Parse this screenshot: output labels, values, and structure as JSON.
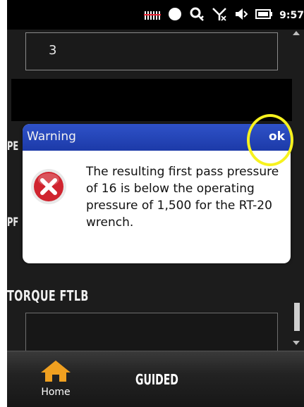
{
  "status_bar": {
    "time": "9:57",
    "icons": [
      "signal-bars-icon",
      "record-icon",
      "sync-icon",
      "no-signal-icon",
      "volume-icon",
      "battery-icon"
    ]
  },
  "form": {
    "field1_value": "3",
    "label_pe_partial": "PE",
    "label_pf_partial": "PF",
    "torque_label": "TORQUE FTLB"
  },
  "dialog": {
    "title": "Warning",
    "ok_label": "ok",
    "icon": "error-icon",
    "message": "The resulting first pass pressure of 16 is below the operating pressure of 1,500 for the RT-20 wrench."
  },
  "bottom_nav": {
    "home_label": "Home",
    "guided_label": "GUIDED"
  },
  "colors": {
    "dialog_header": "#2f52c8",
    "error_red": "#d0242f",
    "home_icon": "#f0a020",
    "highlight": "#f7f21e"
  }
}
